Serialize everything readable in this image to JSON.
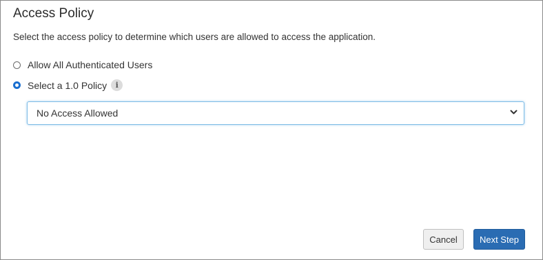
{
  "dialog": {
    "title": "Access Policy",
    "description": "Select the access policy to determine which users are allowed to access the application."
  },
  "options": [
    {
      "label": "Allow All Authenticated Users",
      "selected": false
    },
    {
      "label": "Select a 1.0 Policy",
      "selected": true
    }
  ],
  "info_icon": {
    "glyph": "i",
    "icon": "info-icon"
  },
  "policy_select": {
    "value": "No Access Allowed",
    "icon": "chevron-down-icon"
  },
  "buttons": {
    "cancel": "Cancel",
    "next": "Next Step"
  },
  "colors": {
    "primary": "#2a6cb3",
    "radio_selected": "#1a6fd0",
    "focus_border": "#7fbde6"
  }
}
